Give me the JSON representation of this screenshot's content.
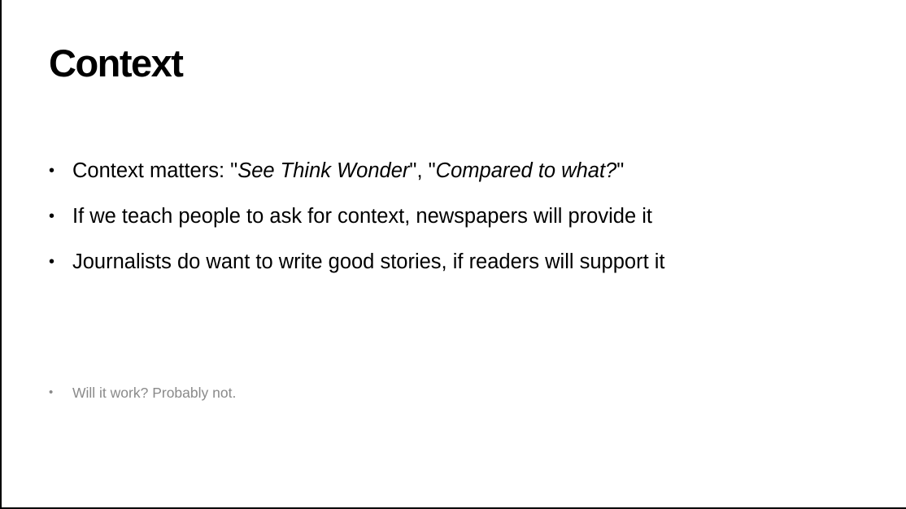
{
  "slide": {
    "title": "Context",
    "bullets": [
      {
        "prefix": "Context matters: \"",
        "em1": "See Think Wonder",
        "mid": "\", \"",
        "em2": "Compared to what?",
        "suffix": "\""
      },
      {
        "text": "If we teach people to ask for context, newspapers will provide it"
      },
      {
        "text": "Journalists do want to write good stories, if readers will support it"
      }
    ],
    "note": "Will it work? Probably not.",
    "bullet_glyph": "•",
    "colors": {
      "text": "#000000",
      "note": "#8a8a8a",
      "background": "#ffffff"
    }
  }
}
